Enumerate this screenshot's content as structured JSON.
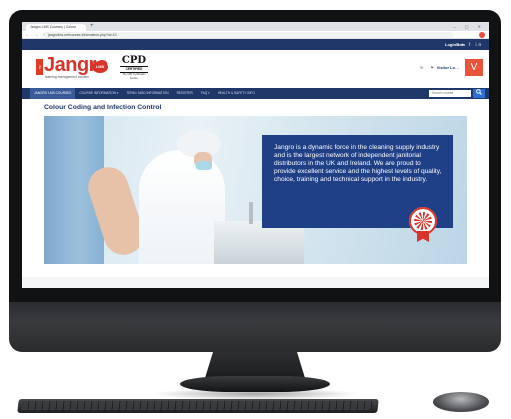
{
  "browser": {
    "tab_title": "Jangro LMS Courses | Colour",
    "new_tab": "+",
    "window_controls": "– ▢ ✕",
    "nav_icons": "← → C",
    "url": "jangrolms.net/course-information-php?id=10"
  },
  "top_strip": {
    "login": "Login now",
    "social": "G+ f in"
  },
  "header": {
    "logo_the": "the",
    "logo_word": "Jangro",
    "logo_lms": "LMS",
    "logo_sub": "learning management solution",
    "cpd_big": "CPD",
    "cpd_small": "CERTIFIED",
    "cpd_tiny": "The CPD Certification Service",
    "icons": "✉ ⚑",
    "visitor": "Visitor Lo…",
    "avatar_letter": "V"
  },
  "menu": {
    "items": [
      {
        "label": "JANGRO LMS COURSES"
      },
      {
        "label": "COURSE INFORMATION ▾"
      },
      {
        "label": "TERM / MOD INFORMATION"
      },
      {
        "label": "REGISTER"
      },
      {
        "label": "FAQ ▾"
      },
      {
        "label": "HEALTH & SAFETY INFO"
      }
    ],
    "search_placeholder": "Search course",
    "search_icon": "magnifier-icon"
  },
  "page": {
    "title": "Colour Coding and Infection Control",
    "info_text": "Jangro is a dynamic force in the cleaning supply industry and is the largest network of independent janitorial distributors in the UK and Ireland. We are proud to provide excellent service and the highest levels of quality, choice, training and technical support in the industry."
  },
  "colors": {
    "brand_navy": "#1f3869",
    "brand_red": "#d8342a",
    "avatar_orange": "#e8553b",
    "search_blue": "#2a6fd1"
  }
}
